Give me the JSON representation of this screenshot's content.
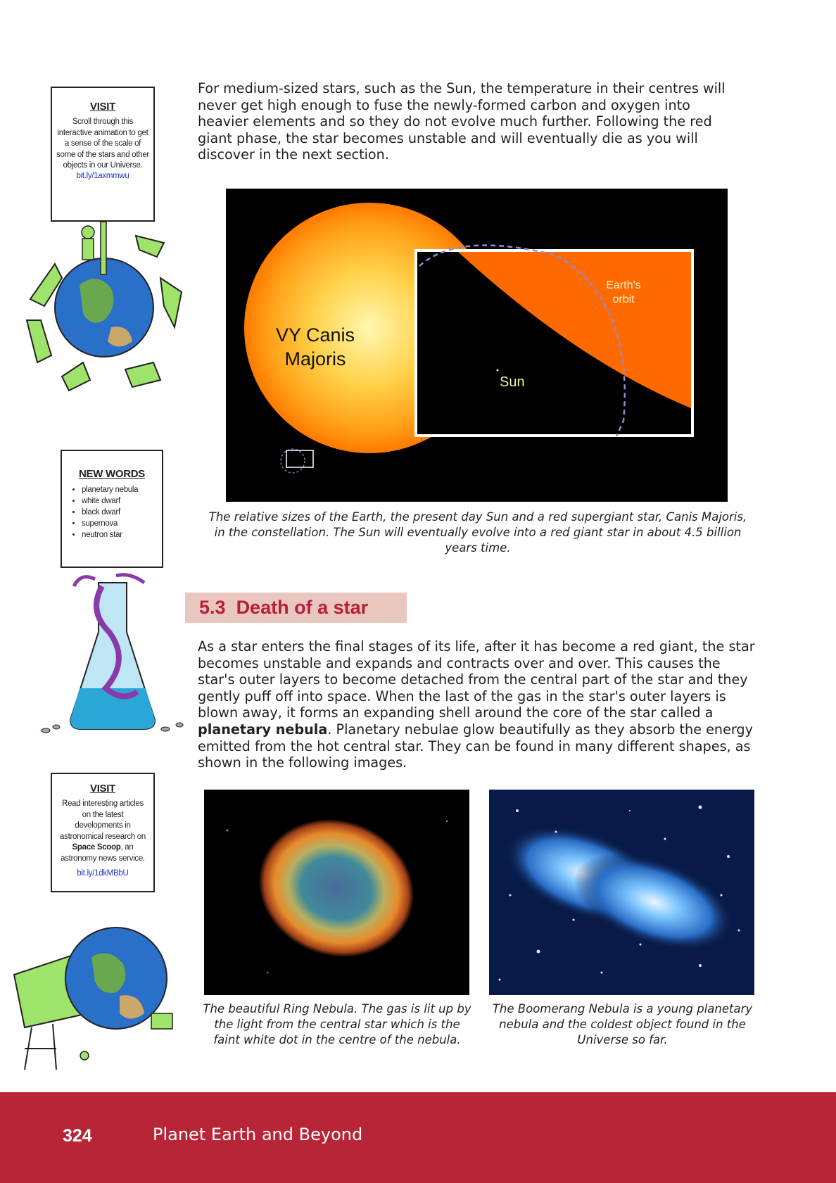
{
  "intro_paragraph": "For medium-sized stars, such as the Sun, the temperature in their centres will never get high enough to fuse the newly-formed carbon and oxygen into heavier elements and so they do not evolve much further. Following the red giant phase, the star becomes unstable and will eventually die as you will discover in the next section.",
  "figure_main": {
    "star_label_line1": "VY Canis",
    "star_label_line2": "Majoris",
    "orbit_label_line1": "Earth's",
    "orbit_label_line2": "orbit",
    "sun_label": "Sun",
    "caption": "The relative sizes of the Earth, the present day Sun and a red supergiant star, Canis Majoris, in the constellation. The Sun will eventually evolve into a red giant star in about 4.5 billion years time."
  },
  "section": {
    "number": "5.3",
    "title": "Death of a star"
  },
  "body_paragraph": {
    "before_bold": "As a star enters the final stages of its life, after it has become a red giant, the star becomes unstable and expands and contracts over and over. This causes the star's outer layers to become detached from the central part of the star and they gently puff off into space. When the last of the gas in the star's outer layers is blown away, it forms an expanding shell around the core of the star called a ",
    "bold": "planetary nebula",
    "after_bold": ". Planetary nebulae glow beautifully as they absorb the energy emitted from the hot central star. They can be found in many different shapes, as shown in the following images."
  },
  "image_captions": {
    "ring": "The beautiful Ring Nebula. The gas is lit up by the light from the central star which is the faint white dot in the centre of the nebula.",
    "boomerang": "The Boomerang Nebula is a young planetary nebula and the coldest object found in the Universe so far."
  },
  "sidebar": {
    "visit1": {
      "title": "VISIT",
      "body": "Scroll through this interactive animation to get a sense of the scale of some of the stars and other objects in our Universe.",
      "link": "bit.ly/1axmmwu"
    },
    "new_words": {
      "title": "NEW WORDS",
      "items": [
        "planetary nebula",
        "white dwarf",
        "black dwarf",
        "supernova",
        "neutron star"
      ]
    },
    "visit2": {
      "title": "VISIT",
      "body_before": "Read interesting articles on the latest developments in astronomical research on ",
      "body_bold": "Space Scoop",
      "body_after": ", an astronomy news service.",
      "link": "bit.ly/1dkMBbU"
    }
  },
  "footer": {
    "page_number": "324",
    "book_title": "Planet Earth and Beyond"
  },
  "colors": {
    "footer_bg": "#b82537",
    "heading_text": "#b81e36",
    "heading_bg": "#eac6c0",
    "link": "#2233cc"
  }
}
